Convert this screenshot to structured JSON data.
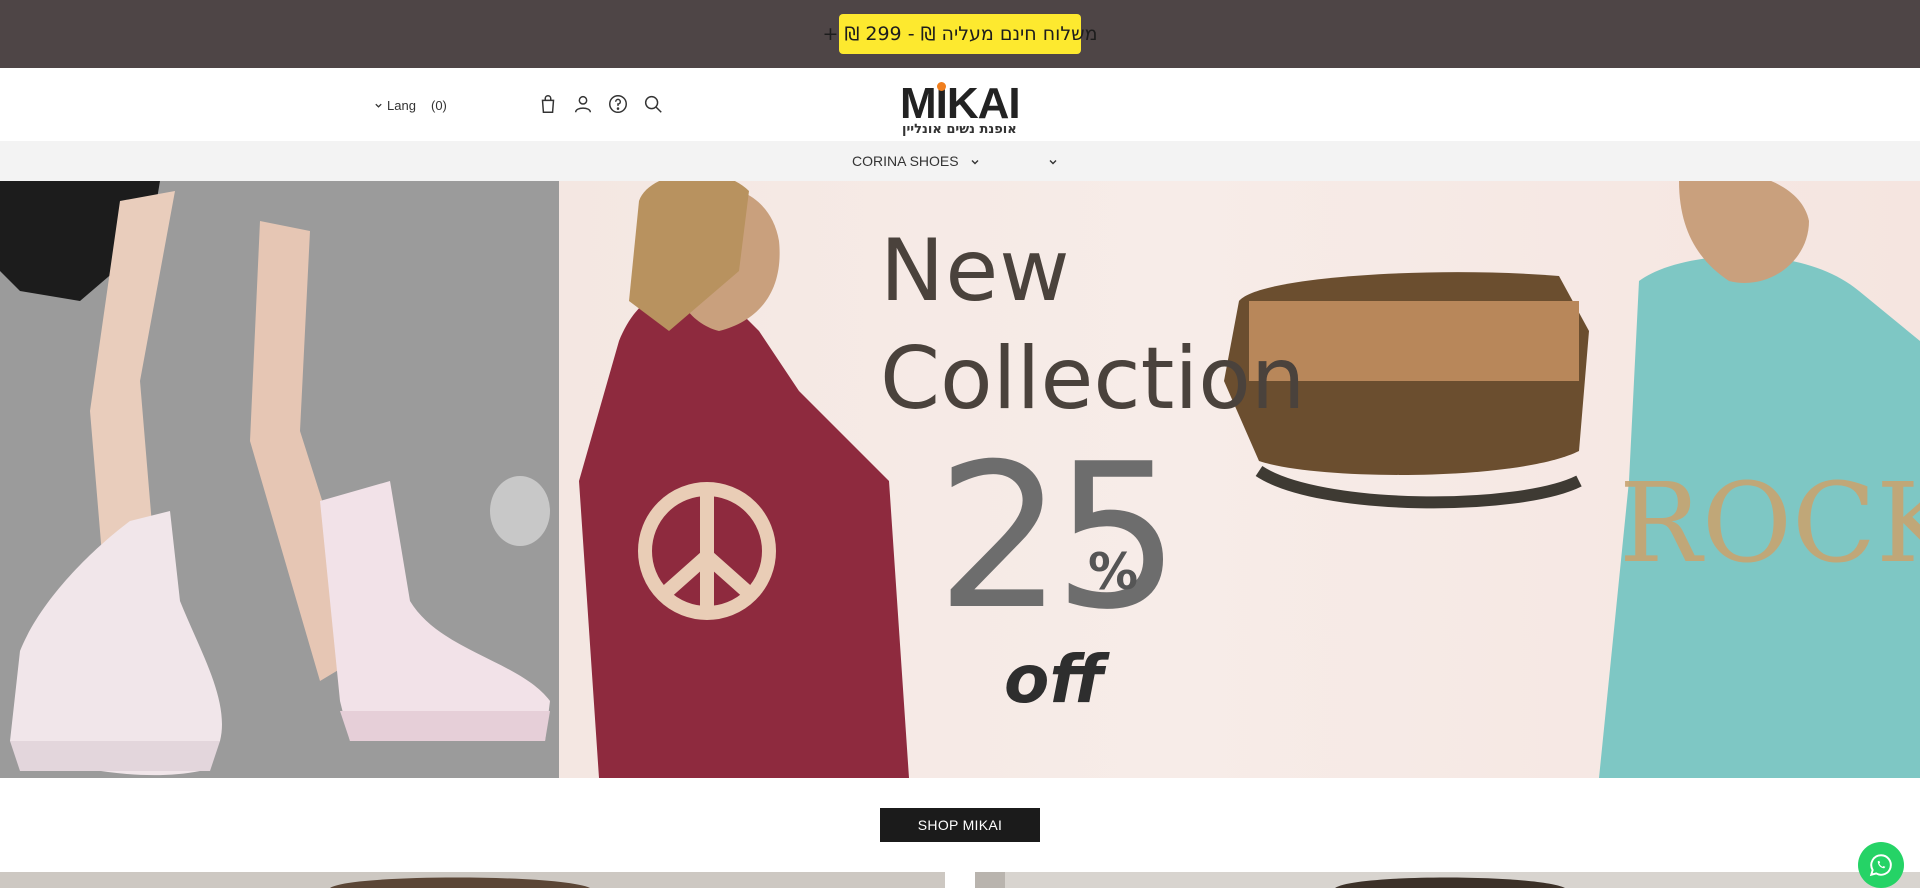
{
  "announcement": {
    "text": "+ ₪ 299 - ₪ משלוח חינם מעליה"
  },
  "header": {
    "lang_label": "Lang",
    "cart_count": "(0)",
    "icons": [
      "bag-icon",
      "user-icon",
      "help-icon",
      "search-icon"
    ]
  },
  "logo": {
    "word": "MIKAI",
    "subtitle": "אופנת נשים אונליין",
    "dot_color": "#f07e1d"
  },
  "nav": {
    "items": [
      {
        "label": "CORINA SHOES",
        "has_dropdown": true
      },
      {
        "label": "",
        "has_dropdown": true
      }
    ]
  },
  "hero": {
    "line1": "New",
    "line2": "Collection",
    "discount": "25",
    "percent": "%",
    "off": "off"
  },
  "cta": {
    "shop_label": "SHOP MIKAI"
  },
  "colors": {
    "announcement_bg": "#4e4546",
    "pill_bg": "#fde92f",
    "nav_bg": "#f3f3f3",
    "button_bg": "#1b1b1b",
    "whatsapp": "#25d366"
  }
}
